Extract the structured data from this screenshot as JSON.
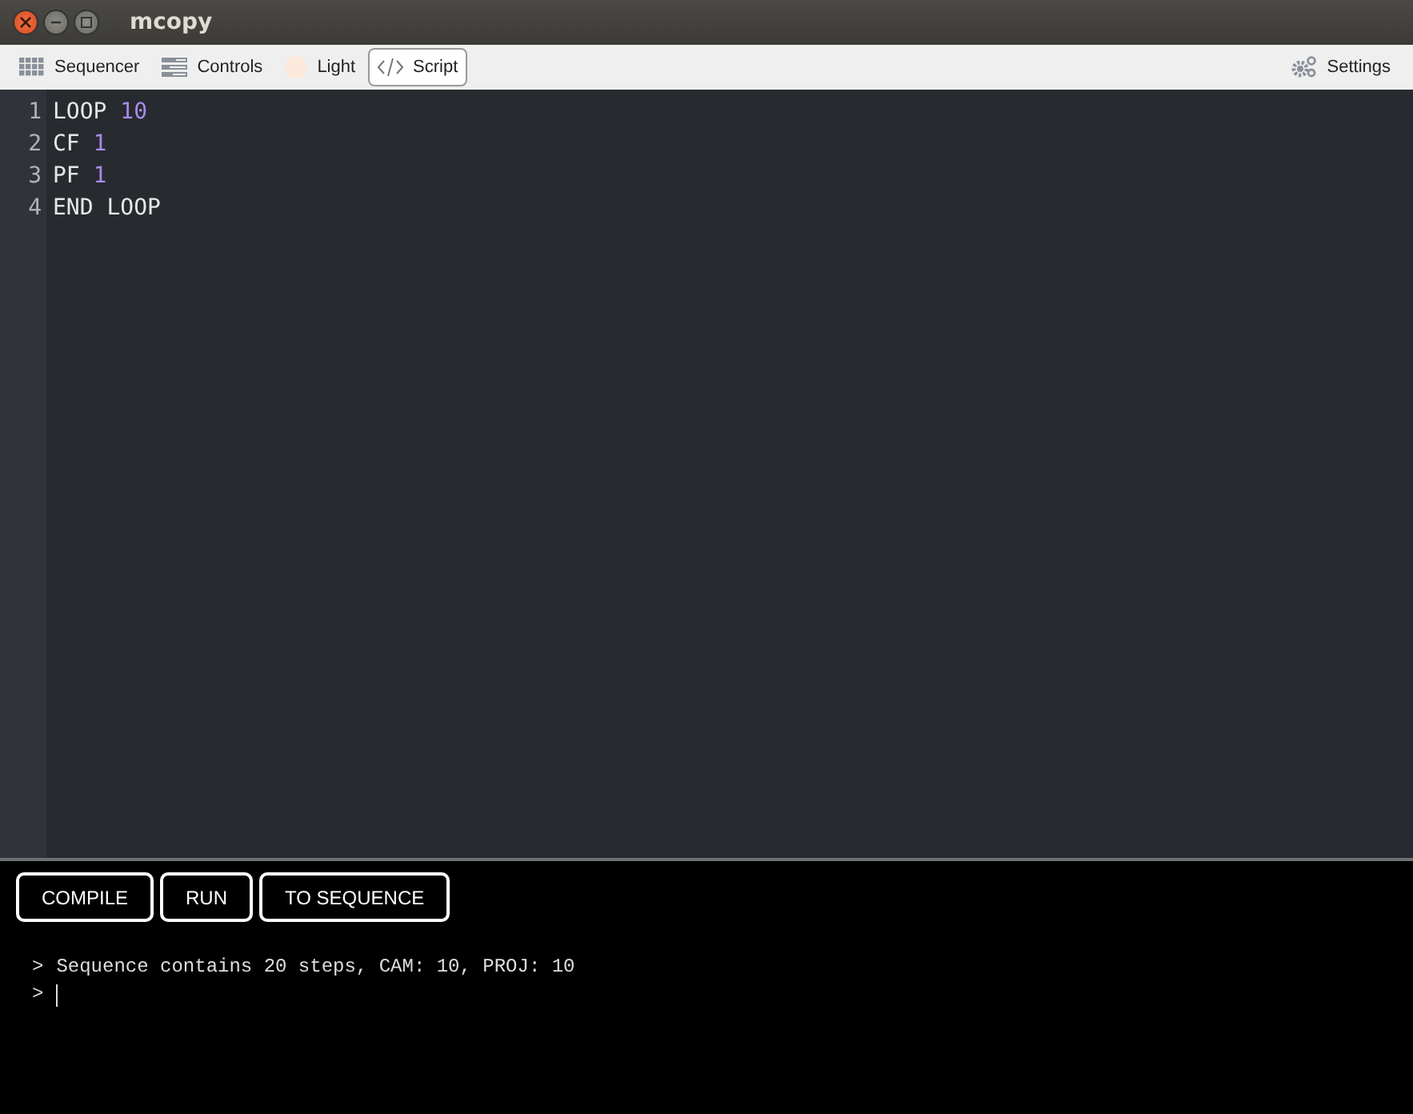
{
  "window": {
    "title": "mcopy"
  },
  "tabs": [
    {
      "label": "Sequencer",
      "kind": "grid",
      "selected": false
    },
    {
      "label": "Controls",
      "kind": "sliders",
      "selected": false
    },
    {
      "label": "Light",
      "kind": "light",
      "selected": false
    },
    {
      "label": "Script",
      "kind": "code",
      "selected": true
    }
  ],
  "settings": {
    "label": "Settings"
  },
  "editor": {
    "lines": [
      {
        "number": "1",
        "tokens": [
          {
            "text": "LOOP",
            "kind": "keyword"
          },
          {
            "text": "10",
            "kind": "number"
          }
        ]
      },
      {
        "number": "2",
        "tokens": [
          {
            "text": "CF",
            "kind": "keyword"
          },
          {
            "text": "1",
            "kind": "number"
          }
        ]
      },
      {
        "number": "3",
        "tokens": [
          {
            "text": "PF",
            "kind": "keyword"
          },
          {
            "text": "1",
            "kind": "number"
          }
        ]
      },
      {
        "number": "4",
        "tokens": [
          {
            "text": "END LOOP",
            "kind": "keyword"
          }
        ]
      }
    ]
  },
  "buttons": [
    "COMPILE",
    "RUN",
    "TO SEQUENCE"
  ],
  "console": {
    "lines": [
      {
        "prompt": ">",
        "text": "Sequence contains 20 steps, CAM: 10, PROJ: 10",
        "cursor": false
      },
      {
        "prompt": ">",
        "cursor": true
      }
    ]
  }
}
